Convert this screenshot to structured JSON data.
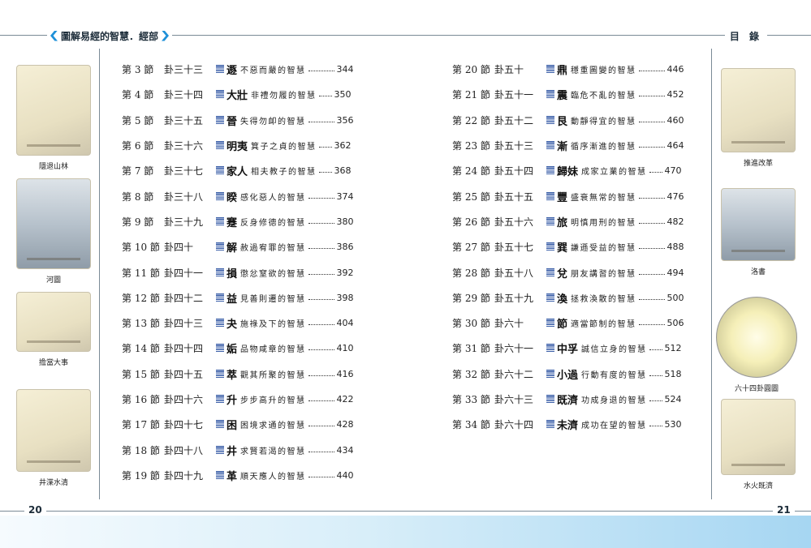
{
  "header": {
    "book_title": "圖解易經的智慧．經部",
    "section_title": "目 錄"
  },
  "footer": {
    "left_page": "20",
    "right_page": "21"
  },
  "side_figures": {
    "left": [
      {
        "caption": "隱退山林"
      },
      {
        "caption": "河圖"
      },
      {
        "caption": "擔當大事"
      },
      {
        "caption": "井渫水清"
      }
    ],
    "right": [
      {
        "caption": "推進改革"
      },
      {
        "caption": "洛書"
      },
      {
        "caption": "六十四卦圓圖"
      },
      {
        "caption": "水火既濟"
      }
    ]
  },
  "toc_left": [
    {
      "section": "第 3 節",
      "gua": "卦三十三",
      "name": "遯",
      "title": "不惡而嚴的智慧",
      "page": "344"
    },
    {
      "section": "第 4 節",
      "gua": "卦三十四",
      "name": "大壯",
      "title": "非禮勿履的智慧",
      "page": "350"
    },
    {
      "section": "第 5 節",
      "gua": "卦三十五",
      "name": "晉",
      "title": "失得勿卹的智慧",
      "page": "356"
    },
    {
      "section": "第 6 節",
      "gua": "卦三十六",
      "name": "明夷",
      "title": "箕子之貞的智慧",
      "page": "362"
    },
    {
      "section": "第 7 節",
      "gua": "卦三十七",
      "name": "家人",
      "title": "相夫教子的智慧",
      "page": "368"
    },
    {
      "section": "第 8 節",
      "gua": "卦三十八",
      "name": "睽",
      "title": "感化惡人的智慧",
      "page": "374"
    },
    {
      "section": "第 9 節",
      "gua": "卦三十九",
      "name": "蹇",
      "title": "反身修德的智慧",
      "page": "380"
    },
    {
      "section": "第 10 節",
      "gua": "卦四十",
      "name": "解",
      "title": "赦過宥罪的智慧",
      "page": "386"
    },
    {
      "section": "第 11 節",
      "gua": "卦四十一",
      "name": "損",
      "title": "懲忿窒欲的智慧",
      "page": "392"
    },
    {
      "section": "第 12 節",
      "gua": "卦四十二",
      "name": "益",
      "title": "見善則遷的智慧",
      "page": "398"
    },
    {
      "section": "第 13 節",
      "gua": "卦四十三",
      "name": "夬",
      "title": "施祿及下的智慧",
      "page": "404"
    },
    {
      "section": "第 14 節",
      "gua": "卦四十四",
      "name": "姤",
      "title": "品物咸章的智慧",
      "page": "410"
    },
    {
      "section": "第 15 節",
      "gua": "卦四十五",
      "name": "萃",
      "title": "觀其所聚的智慧",
      "page": "416"
    },
    {
      "section": "第 16 節",
      "gua": "卦四十六",
      "name": "升",
      "title": "步步高升的智慧",
      "page": "422"
    },
    {
      "section": "第 17 節",
      "gua": "卦四十七",
      "name": "困",
      "title": "困境求通的智慧",
      "page": "428"
    },
    {
      "section": "第 18 節",
      "gua": "卦四十八",
      "name": "井",
      "title": "求賢若渴的智慧",
      "page": "434"
    },
    {
      "section": "第 19 節",
      "gua": "卦四十九",
      "name": "革",
      "title": "順天應人的智慧",
      "page": "440"
    }
  ],
  "toc_right": [
    {
      "section": "第 20 節",
      "gua": "卦五十",
      "name": "鼎",
      "title": "穩重圖變的智慧",
      "page": "446"
    },
    {
      "section": "第 21 節",
      "gua": "卦五十一",
      "name": "震",
      "title": "臨危不亂的智慧",
      "page": "452"
    },
    {
      "section": "第 22 節",
      "gua": "卦五十二",
      "name": "艮",
      "title": "動靜得宜的智慧",
      "page": "460"
    },
    {
      "section": "第 23 節",
      "gua": "卦五十三",
      "name": "漸",
      "title": "循序漸進的智慧",
      "page": "464"
    },
    {
      "section": "第 24 節",
      "gua": "卦五十四",
      "name": "歸妹",
      "title": "成家立業的智慧",
      "page": "470"
    },
    {
      "section": "第 25 節",
      "gua": "卦五十五",
      "name": "豐",
      "title": "盛衰無常的智慧",
      "page": "476"
    },
    {
      "section": "第 26 節",
      "gua": "卦五十六",
      "name": "旅",
      "title": "明慎用刑的智慧",
      "page": "482"
    },
    {
      "section": "第 27 節",
      "gua": "卦五十七",
      "name": "巽",
      "title": "謙遜受益的智慧",
      "page": "488"
    },
    {
      "section": "第 28 節",
      "gua": "卦五十八",
      "name": "兌",
      "title": "朋友講習的智慧",
      "page": "494"
    },
    {
      "section": "第 29 節",
      "gua": "卦五十九",
      "name": "渙",
      "title": "拯救渙散的智慧",
      "page": "500"
    },
    {
      "section": "第 30 節",
      "gua": "卦六十",
      "name": "節",
      "title": "適當節制的智慧",
      "page": "506"
    },
    {
      "section": "第 31 節",
      "gua": "卦六十一",
      "name": "中孚",
      "title": "誠信立身的智慧",
      "page": "512"
    },
    {
      "section": "第 32 節",
      "gua": "卦六十二",
      "name": "小過",
      "title": "行動有度的智慧",
      "page": "518"
    },
    {
      "section": "第 33 節",
      "gua": "卦六十三",
      "name": "既濟",
      "title": "功成身退的智慧",
      "page": "524"
    },
    {
      "section": "第 34 節",
      "gua": "卦六十四",
      "name": "未濟",
      "title": "成功在望的智慧",
      "page": "530"
    }
  ]
}
